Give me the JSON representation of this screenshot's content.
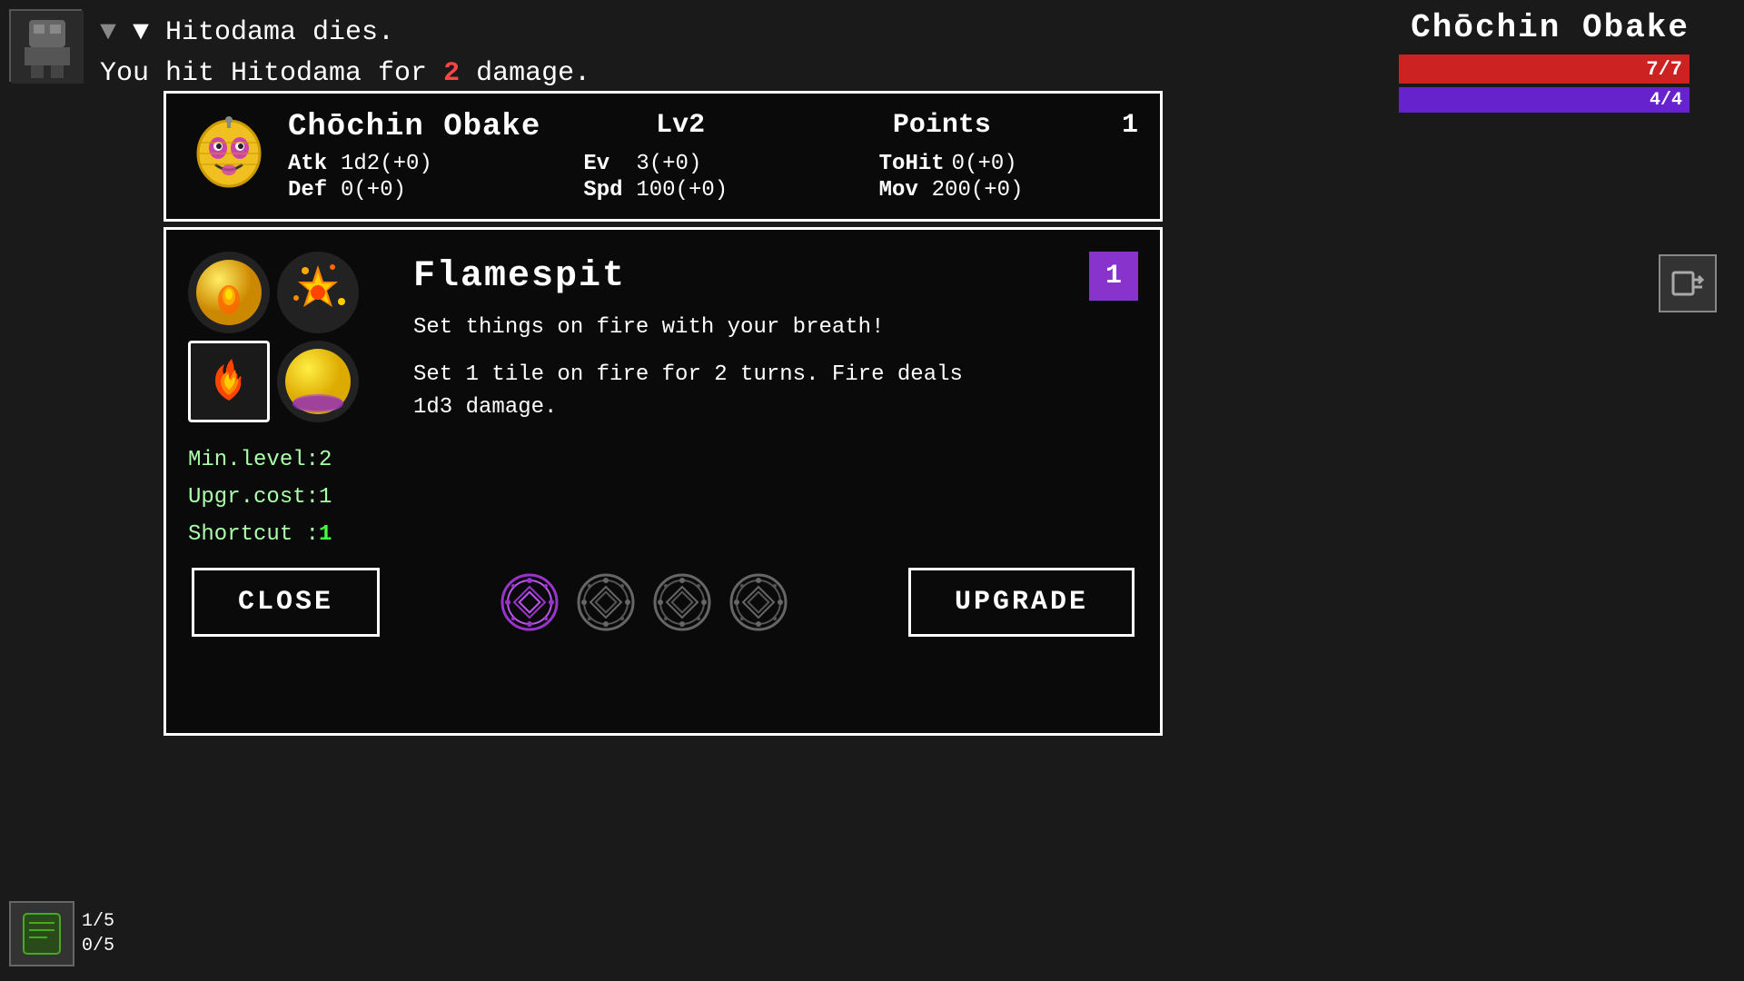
{
  "game": {
    "background_color": "#111111"
  },
  "enemy": {
    "name": "Chōchin Obake",
    "hp": "7/7",
    "mp": "4/4"
  },
  "combat_log": {
    "line1": "▼ Hitodama dies.",
    "line2_prefix": "You hit Hitodama for ",
    "line2_damage": "2",
    "line2_suffix": " damage."
  },
  "character": {
    "name": "Chōchin Obake",
    "level": "Lv2",
    "points_label": "Points",
    "points_value": "1",
    "atk_label": "Atk",
    "atk_value": "1d2(+0)",
    "ev_label": "Ev",
    "ev_value": "3(+0)",
    "tohit_label": "ToHit",
    "tohit_value": "0(+0)",
    "def_label": "Def",
    "def_value": "0(+0)",
    "spd_label": "Spd",
    "spd_value": "100(+0)",
    "mov_label": "Mov",
    "mov_value": "200(+0)"
  },
  "ability": {
    "name": "Flamespit",
    "level": "1",
    "short_desc": "Set things on fire with your breath!",
    "detail": "Set 1 tile on fire for 2 turns. Fire deals\n1d3 damage.",
    "min_level_label": "Min.level:",
    "min_level_value": "2",
    "upgr_cost_label": "Upgr.cost:",
    "upgr_cost_value": "1",
    "shortcut_label": "Shortcut :",
    "shortcut_value": "1"
  },
  "buttons": {
    "close": "CLOSE",
    "upgrade": "UPGRADE"
  },
  "inventory": {
    "slot1_count": "1/5",
    "slot2_count": "0/5"
  }
}
